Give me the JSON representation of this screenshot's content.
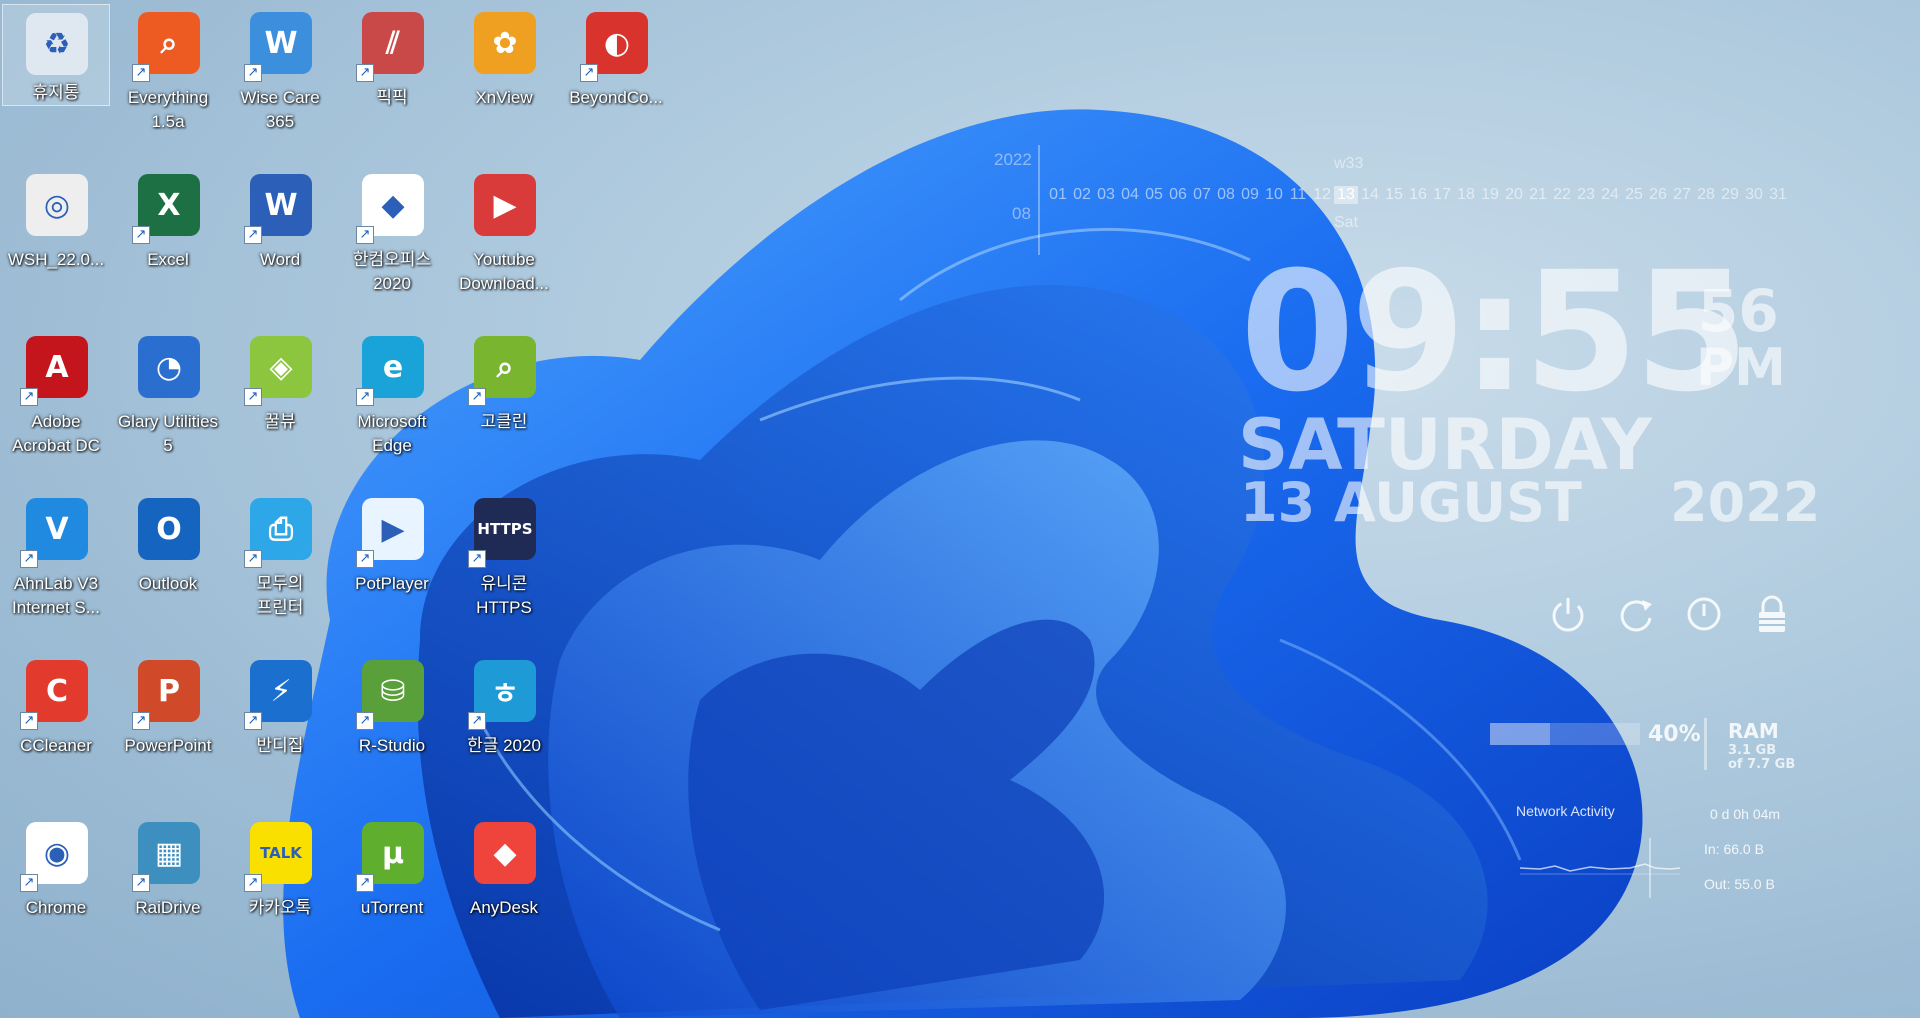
{
  "desktop": {
    "icons": [
      {
        "label": "휴지통",
        "icon": "recycle-bin-icon",
        "color": "#dfe8f1",
        "glyph": "♻",
        "shortcut": false,
        "selected": true
      },
      {
        "label": "Everything\n1.5a",
        "icon": "magnifier-icon",
        "color": "#ee5b22",
        "glyph": "⌕",
        "shortcut": true
      },
      {
        "label": "Wise Care\n365",
        "icon": "shield-w-icon",
        "color": "#3b8fdc",
        "glyph": "W",
        "shortcut": true
      },
      {
        "label": "픽픽",
        "icon": "picpick-stripes-icon",
        "color": "#c94848",
        "glyph": "⫽",
        "shortcut": true
      },
      {
        "label": "XnView",
        "icon": "xnview-icon",
        "color": "#f0a020",
        "glyph": "✿",
        "shortcut": false
      },
      {
        "label": "BeyondCo...",
        "icon": "beyond-compare-icon",
        "color": "#d9332e",
        "glyph": "◐",
        "shortcut": true
      },
      {
        "label": "WSH_22.0...",
        "icon": "disc-image-file-icon",
        "color": "#eeeeee",
        "glyph": "◎",
        "shortcut": false
      },
      {
        "label": "Excel",
        "icon": "excel-icon",
        "color": "#1d7044",
        "glyph": "X",
        "shortcut": true
      },
      {
        "label": "Word",
        "icon": "word-icon",
        "color": "#2b5fb8",
        "glyph": "W",
        "shortcut": true
      },
      {
        "label": "한컴오피스\n2020",
        "icon": "hancom-office-icon",
        "color": "#ffffff",
        "glyph": "◆",
        "shortcut": true
      },
      {
        "label": "Youtube\nDownload...",
        "icon": "youtube-downloader-icon",
        "color": "#d93a3a",
        "glyph": "▶",
        "shortcut": false
      },
      {
        "label": "Adobe\nAcrobat DC",
        "icon": "acrobat-icon",
        "color": "#c4151c",
        "glyph": "A",
        "shortcut": true
      },
      {
        "label": "Glary Utilities\n5",
        "icon": "glary-utilities-icon",
        "color": "#2a6fd0",
        "glyph": "◔",
        "shortcut": false
      },
      {
        "label": "꿀뷰",
        "icon": "honeyview-icon",
        "color": "#8cc63e",
        "glyph": "◈",
        "shortcut": true
      },
      {
        "label": "Microsoft\nEdge",
        "icon": "edge-icon",
        "color": "#1aa3d8",
        "glyph": "e",
        "shortcut": true
      },
      {
        "label": "고클린",
        "icon": "goclean-icon",
        "color": "#7ab530",
        "glyph": "⌕",
        "shortcut": true
      },
      {
        "label": "AhnLab V3\nInternet S...",
        "icon": "ahnlab-v3-icon",
        "color": "#2089e0",
        "glyph": "V",
        "shortcut": true
      },
      {
        "label": "Outlook",
        "icon": "outlook-icon",
        "color": "#1565c0",
        "glyph": "O",
        "shortcut": false
      },
      {
        "label": "모두의\n프린터",
        "icon": "printer-icon",
        "color": "#2ea7e8",
        "glyph": "⎙",
        "shortcut": true
      },
      {
        "label": "PotPlayer",
        "icon": "potplayer-icon",
        "color": "#e8f4ff",
        "glyph": "▶",
        "shortcut": true
      },
      {
        "label": "유니콘\nHTTPS",
        "icon": "unicorn-https-icon",
        "color": "#1f2a55",
        "glyph": "HTTPS",
        "shortcut": true
      },
      {
        "label": "CCleaner",
        "icon": "ccleaner-icon",
        "color": "#e23a2d",
        "glyph": "C",
        "shortcut": true
      },
      {
        "label": "PowerPoint",
        "icon": "powerpoint-icon",
        "color": "#d04a2a",
        "glyph": "P",
        "shortcut": true
      },
      {
        "label": "반디집",
        "icon": "bandizip-icon",
        "color": "#1a6fcf",
        "glyph": "⚡",
        "shortcut": true
      },
      {
        "label": "R-Studio",
        "icon": "r-studio-icon",
        "color": "#5aa03a",
        "glyph": "⛁",
        "shortcut": true
      },
      {
        "label": "한글 2020",
        "icon": "hangul-icon",
        "color": "#1e9ad6",
        "glyph": "ㅎ",
        "shortcut": true
      },
      {
        "label": "Chrome",
        "icon": "chrome-icon",
        "color": "#ffffff",
        "glyph": "◉",
        "shortcut": true
      },
      {
        "label": "RaiDrive",
        "icon": "raidrive-icon",
        "color": "#3c8fbf",
        "glyph": "▦",
        "shortcut": true
      },
      {
        "label": "카카오톡",
        "icon": "kakaotalk-icon",
        "color": "#f9e000",
        "glyph": "TALK",
        "shortcut": true
      },
      {
        "label": "uTorrent",
        "icon": "utorrent-icon",
        "color": "#5fae2e",
        "glyph": "µ",
        "shortcut": true
      },
      {
        "label": "AnyDesk",
        "icon": "anydesk-icon",
        "color": "#ef443b",
        "glyph": "◆",
        "shortcut": false
      }
    ]
  },
  "calendar": {
    "year": "2022",
    "month": "08",
    "week": "w33",
    "weekday": "Sat",
    "days": [
      "01",
      "02",
      "03",
      "04",
      "05",
      "06",
      "07",
      "08",
      "09",
      "10",
      "11",
      "12",
      "13",
      "14",
      "15",
      "16",
      "17",
      "18",
      "19",
      "20",
      "21",
      "22",
      "23",
      "24",
      "25",
      "26",
      "27",
      "28",
      "29",
      "30",
      "31"
    ],
    "today": "13"
  },
  "clock": {
    "hours_minutes": "09:55",
    "seconds": "56",
    "ampm": "PM",
    "day": "SATURDAY",
    "date": "13 AUGUST",
    "year": "2022"
  },
  "system_buttons": [
    {
      "name": "power-icon"
    },
    {
      "name": "restart-icon"
    },
    {
      "name": "shutdown-icon"
    },
    {
      "name": "lock-icon"
    }
  ],
  "ram": {
    "percent": "40%",
    "label": "RAM",
    "used": "3.1 GB",
    "total": "of 7.7 GB",
    "fraction": 0.4
  },
  "network": {
    "title": "Network Activity",
    "uptime": "0 d 0h 04m",
    "in": "In: 66.0 B",
    "out": "Out: 55.0 B"
  },
  "colors": {
    "wallpaper_bg": "#b3cde0",
    "bloom_blue": "#1a6cf0",
    "bloom_dark": "#0a3fc4",
    "widget_text": "#ffffff"
  }
}
